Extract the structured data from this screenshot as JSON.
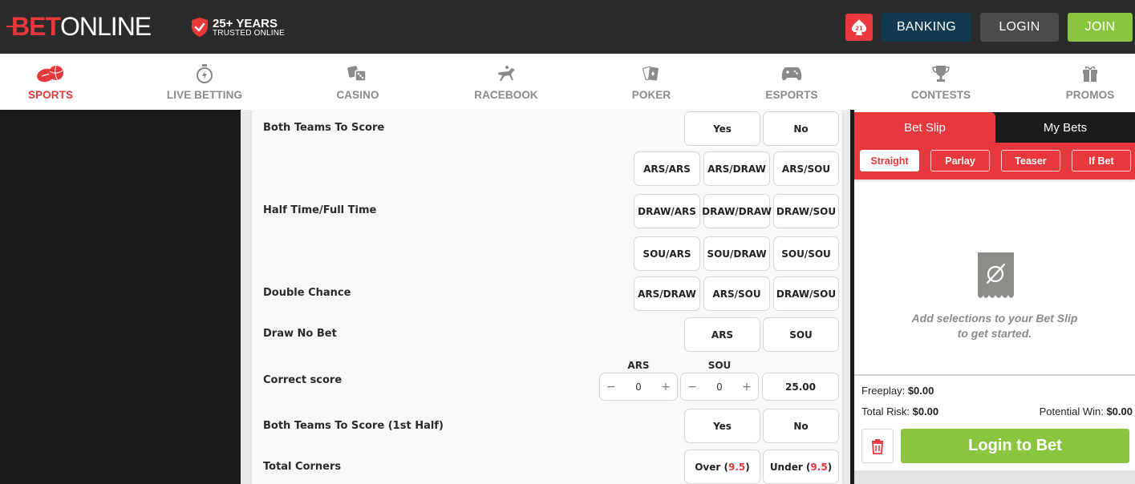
{
  "header": {
    "logo_part1": "BET",
    "logo_part2": "ONLINE",
    "trust_line1": "25+ YEARS",
    "trust_line2": "TRUSTED ONLINE",
    "poker_badge_text": "21",
    "banking_label": "BANKING",
    "login_label": "LOGIN",
    "join_label": "JOIN"
  },
  "nav": {
    "items": [
      {
        "label": "SPORTS",
        "icon": "sports-balls-icon",
        "active": true
      },
      {
        "label": "LIVE BETTING",
        "icon": "stopwatch-icon",
        "active": false
      },
      {
        "label": "CASINO",
        "icon": "dice-icon",
        "active": false
      },
      {
        "label": "RACEBOOK",
        "icon": "horse-racing-icon",
        "active": false
      },
      {
        "label": "POKER",
        "icon": "playing-cards-icon",
        "active": false
      },
      {
        "label": "ESPORTS",
        "icon": "gamepad-icon",
        "active": false
      },
      {
        "label": "CONTESTS",
        "icon": "trophy-icon",
        "active": false
      },
      {
        "label": "PROMOS",
        "icon": "gift-icon",
        "active": false
      }
    ]
  },
  "markets": {
    "both_teams_to_score": {
      "label": "Both Teams To Score",
      "options": [
        "Yes",
        "No"
      ]
    },
    "half_time_full_time": {
      "label": "Half Time/Full Time",
      "options": [
        "ARS/ARS",
        "ARS/DRAW",
        "ARS/SOU",
        "DRAW/ARS",
        "DRAW/DRAW",
        "DRAW/SOU",
        "SOU/ARS",
        "SOU/DRAW",
        "SOU/SOU"
      ]
    },
    "double_chance": {
      "label": "Double Chance",
      "options": [
        "ARS/DRAW",
        "ARS/SOU",
        "DRAW/SOU"
      ]
    },
    "draw_no_bet": {
      "label": "Draw No Bet",
      "options": [
        "ARS",
        "SOU"
      ]
    },
    "correct_score": {
      "label": "Correct score",
      "home_label": "ARS",
      "home_value": "0",
      "away_label": "SOU",
      "away_value": "0",
      "minus": "−",
      "plus": "+",
      "odds": "25.00"
    },
    "both_teams_to_score_1h": {
      "label": "Both Teams To Score (1st Half)",
      "options": [
        "Yes",
        "No"
      ]
    },
    "total_corners": {
      "label": "Total Corners",
      "over_label": "Over",
      "under_label": "Under",
      "line": "9.5"
    }
  },
  "bet_slip": {
    "tab_active": "Bet Slip",
    "tab_other": "My Bets",
    "types": [
      "Straight",
      "Parlay",
      "Teaser",
      "If Bet"
    ],
    "active_type": "Straight",
    "empty_line1": "Add selections to your Bet Slip",
    "empty_line2": "to get started.",
    "freeplay_label": "Freeplay:",
    "freeplay_value": "$0.00",
    "total_risk_label": "Total Risk:",
    "total_risk_value": "$0.00",
    "potential_win_label": "Potential Win:",
    "potential_win_value": "$0.00",
    "login_to_bet_label": "Login to Bet"
  },
  "colors": {
    "brand_red": "#e8383b",
    "join_green": "#8bc53f",
    "banking_blue": "#113a50",
    "login_gray": "#4b4b4b"
  }
}
